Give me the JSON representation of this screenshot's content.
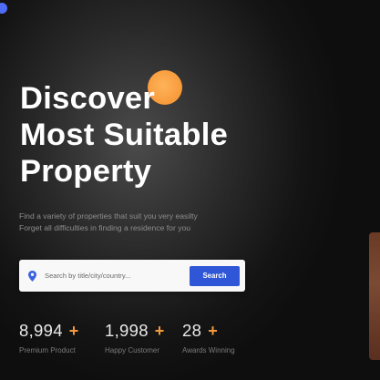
{
  "hero": {
    "title_line1": "Discover",
    "title_line2": "Most Suitable",
    "title_line3": "Property",
    "subtitle_line1": "Find a variety of properties that suit you very easilty",
    "subtitle_line2": "Forget all difficulties in finding a residence for you"
  },
  "search": {
    "placeholder": "Search by title/city/country...",
    "button_label": "Search",
    "icon": "location-pin-icon"
  },
  "stats": [
    {
      "value": "8,994",
      "plus": "+",
      "label": "Premium Product"
    },
    {
      "value": "1,998",
      "plus": "+",
      "label": "Happy Customer"
    },
    {
      "value": "28",
      "plus": "+",
      "label": "Awards Winning"
    }
  ],
  "colors": {
    "accent_orange": "#f79a3a",
    "primary_blue": "#2f56d6",
    "background": "#141414"
  }
}
